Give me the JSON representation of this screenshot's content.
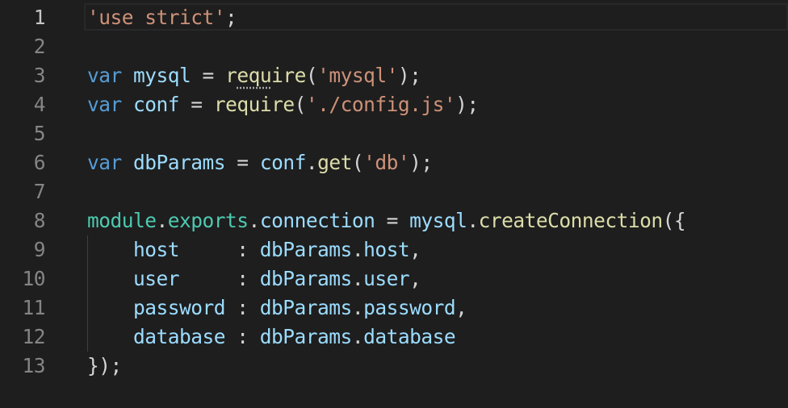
{
  "editor": {
    "line_numbers": [
      "1",
      "2",
      "3",
      "4",
      "5",
      "6",
      "7",
      "8",
      "9",
      "10",
      "11",
      "12",
      "13"
    ],
    "lines": [
      [
        {
          "t": "'use strict'",
          "c": "string"
        },
        {
          "t": ";",
          "c": "plain"
        }
      ],
      [],
      [
        {
          "t": "var",
          "c": "keyword"
        },
        {
          "t": " ",
          "c": "plain"
        },
        {
          "t": "mysql",
          "c": "var"
        },
        {
          "t": " = ",
          "c": "plain"
        },
        {
          "t": "r",
          "c": "func"
        },
        {
          "t": "equ",
          "c": "func",
          "squiggle": true
        },
        {
          "t": "ire",
          "c": "func"
        },
        {
          "t": "(",
          "c": "plain"
        },
        {
          "t": "'mysql'",
          "c": "string"
        },
        {
          "t": ");",
          "c": "plain"
        }
      ],
      [
        {
          "t": "var",
          "c": "keyword"
        },
        {
          "t": " ",
          "c": "plain"
        },
        {
          "t": "conf",
          "c": "var"
        },
        {
          "t": " = ",
          "c": "plain"
        },
        {
          "t": "require",
          "c": "func"
        },
        {
          "t": "(",
          "c": "plain"
        },
        {
          "t": "'./config.js'",
          "c": "string"
        },
        {
          "t": ");",
          "c": "plain"
        }
      ],
      [],
      [
        {
          "t": "var",
          "c": "keyword"
        },
        {
          "t": " ",
          "c": "plain"
        },
        {
          "t": "dbParams",
          "c": "var"
        },
        {
          "t": " = ",
          "c": "plain"
        },
        {
          "t": "conf",
          "c": "var"
        },
        {
          "t": ".",
          "c": "plain"
        },
        {
          "t": "get",
          "c": "func"
        },
        {
          "t": "(",
          "c": "plain"
        },
        {
          "t": "'db'",
          "c": "string"
        },
        {
          "t": ");",
          "c": "plain"
        }
      ],
      [],
      [
        {
          "t": "module",
          "c": "module"
        },
        {
          "t": ".",
          "c": "plain"
        },
        {
          "t": "exports",
          "c": "module"
        },
        {
          "t": ".",
          "c": "plain"
        },
        {
          "t": "connection",
          "c": "var"
        },
        {
          "t": " = ",
          "c": "plain"
        },
        {
          "t": "mysql",
          "c": "var"
        },
        {
          "t": ".",
          "c": "plain"
        },
        {
          "t": "createConnection",
          "c": "func"
        },
        {
          "t": "({",
          "c": "plain"
        }
      ],
      [
        {
          "t": "    ",
          "c": "plain"
        },
        {
          "t": "host",
          "c": "var"
        },
        {
          "t": "     : ",
          "c": "plain"
        },
        {
          "t": "dbParams",
          "c": "var"
        },
        {
          "t": ".",
          "c": "plain"
        },
        {
          "t": "host",
          "c": "var"
        },
        {
          "t": ",",
          "c": "plain"
        }
      ],
      [
        {
          "t": "    ",
          "c": "plain"
        },
        {
          "t": "user",
          "c": "var"
        },
        {
          "t": "     : ",
          "c": "plain"
        },
        {
          "t": "dbParams",
          "c": "var"
        },
        {
          "t": ".",
          "c": "plain"
        },
        {
          "t": "user",
          "c": "var"
        },
        {
          "t": ",",
          "c": "plain"
        }
      ],
      [
        {
          "t": "    ",
          "c": "plain"
        },
        {
          "t": "password",
          "c": "var"
        },
        {
          "t": " : ",
          "c": "plain"
        },
        {
          "t": "dbParams",
          "c": "var"
        },
        {
          "t": ".",
          "c": "plain"
        },
        {
          "t": "password",
          "c": "var"
        },
        {
          "t": ",",
          "c": "plain"
        }
      ],
      [
        {
          "t": "    ",
          "c": "plain"
        },
        {
          "t": "database",
          "c": "var"
        },
        {
          "t": " : ",
          "c": "plain"
        },
        {
          "t": "dbParams",
          "c": "var"
        },
        {
          "t": ".",
          "c": "plain"
        },
        {
          "t": "database",
          "c": "var"
        }
      ],
      [
        {
          "t": "});",
          "c": "plain"
        }
      ]
    ],
    "active_line": 1
  },
  "colors": {
    "background": "#1e1e1e",
    "keyword": "#569cd6",
    "variable": "#9cdcfe",
    "function": "#dcdcaa",
    "string": "#ce9178",
    "module": "#4ec9b0",
    "plain": "#d4d4d4",
    "line_number": "#858585",
    "line_number_active": "#c6c6c6"
  }
}
